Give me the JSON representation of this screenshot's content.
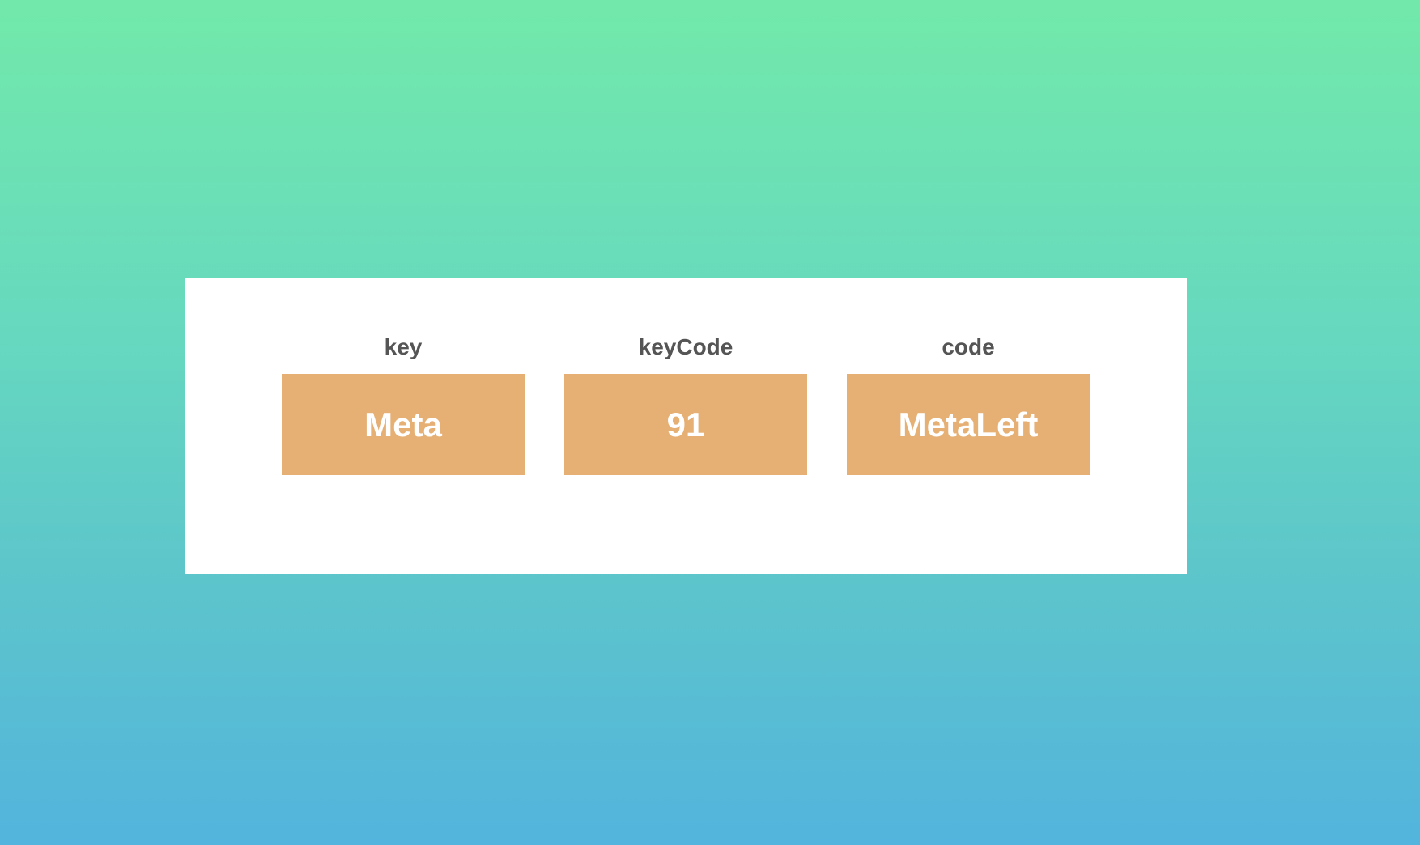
{
  "colors": {
    "background_top": "#72e9aa",
    "background_bottom": "#53b4dd",
    "card": "#ffffff",
    "key_box": "#e6b074",
    "label_text": "#555555",
    "value_text": "#ffffff"
  },
  "keys": [
    {
      "label": "key",
      "value": "Meta"
    },
    {
      "label": "keyCode",
      "value": "91"
    },
    {
      "label": "code",
      "value": "MetaLeft"
    }
  ]
}
